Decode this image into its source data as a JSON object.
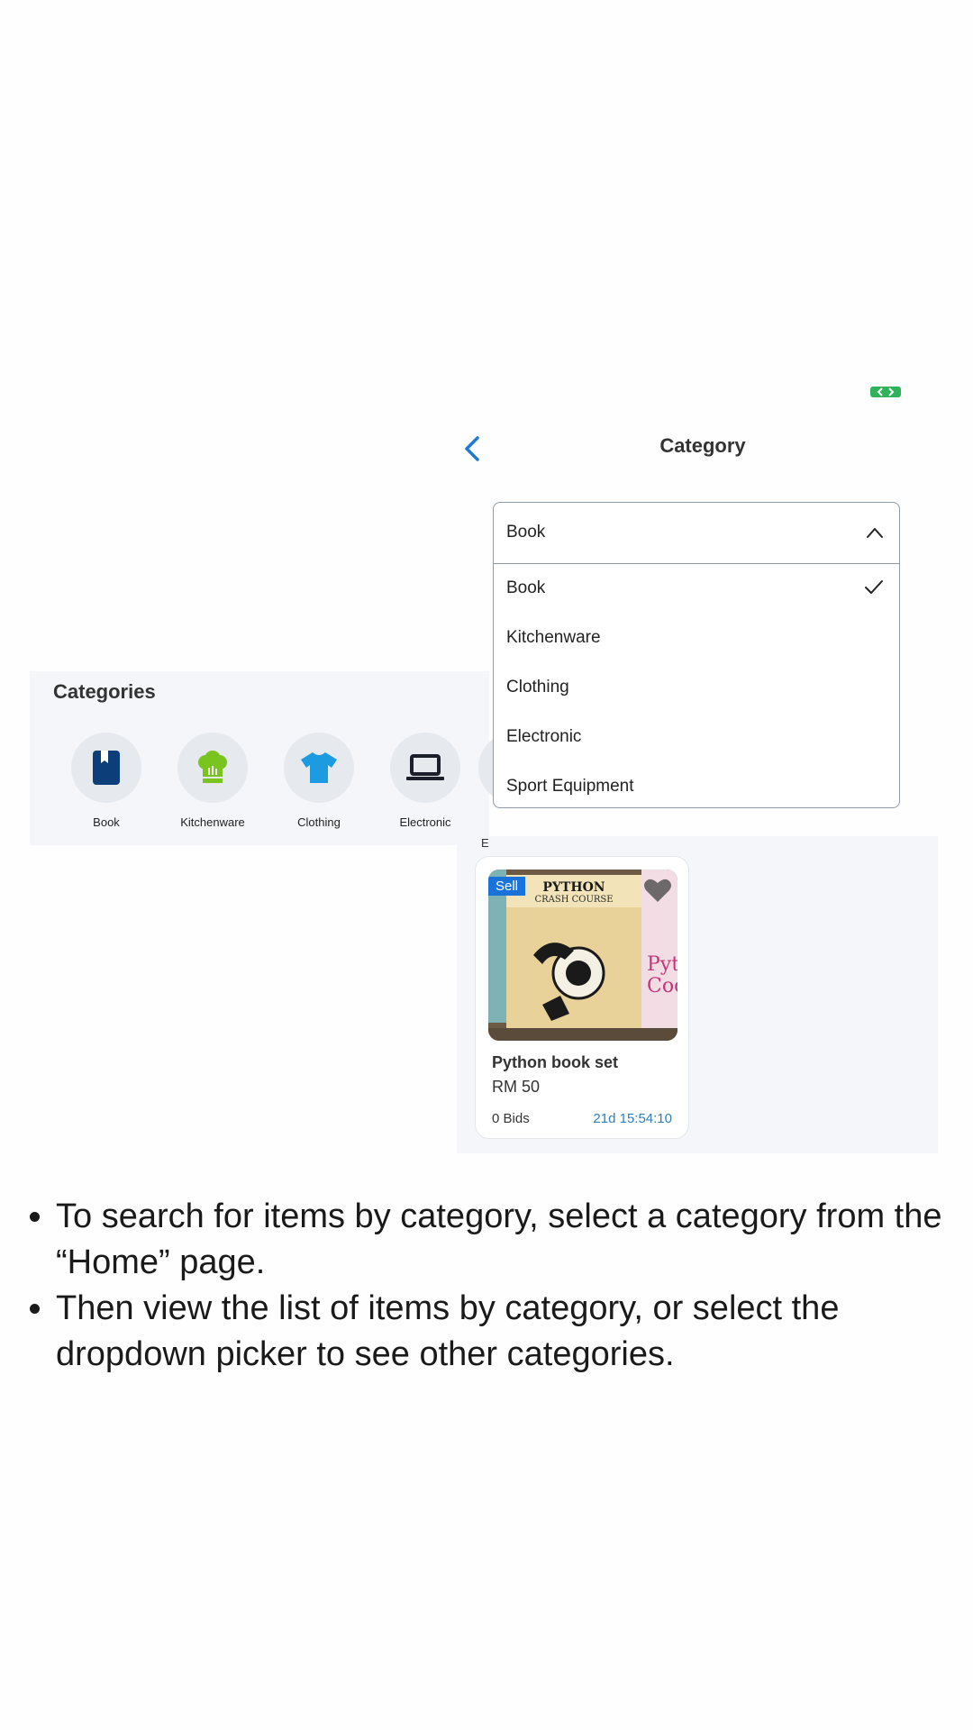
{
  "nav": {
    "title": "Category"
  },
  "categories_panel": {
    "heading": "Categories",
    "items": [
      {
        "label": "Book",
        "icon": "book-icon",
        "color": "#0c3f7a"
      },
      {
        "label": "Kitchenware",
        "icon": "chef-hat-icon",
        "color": "#7ac41f"
      },
      {
        "label": "Clothing",
        "icon": "tshirt-icon",
        "color": "#1d9be0"
      },
      {
        "label": "Electronic",
        "icon": "laptop-icon",
        "color": "#1b1f2a"
      }
    ]
  },
  "dropdown": {
    "selected": "Book",
    "options": [
      {
        "label": "Book",
        "checked": true
      },
      {
        "label": "Kitchenware",
        "checked": false
      },
      {
        "label": "Clothing",
        "checked": false
      },
      {
        "label": "Electronic",
        "checked": false
      },
      {
        "label": "Sport Equipment",
        "checked": false
      }
    ]
  },
  "listing": {
    "cut_label": "E",
    "card": {
      "tag": "Sell",
      "cover_title": "PYTHON",
      "cover_subtitle": "CRASH COURSE",
      "title": "Python book set",
      "price": "RM 50",
      "bids": "0 Bids",
      "timer": "21d 15:54:10"
    }
  },
  "instructions": [
    "To search for items by category, select a category from the “Home” page.",
    "Then view the list of items by category, or select the dropdown picker to see other categories."
  ],
  "colors": {
    "accent": "#1a73d9",
    "timer": "#2d7fbf",
    "status_green": "#2fb35a"
  }
}
